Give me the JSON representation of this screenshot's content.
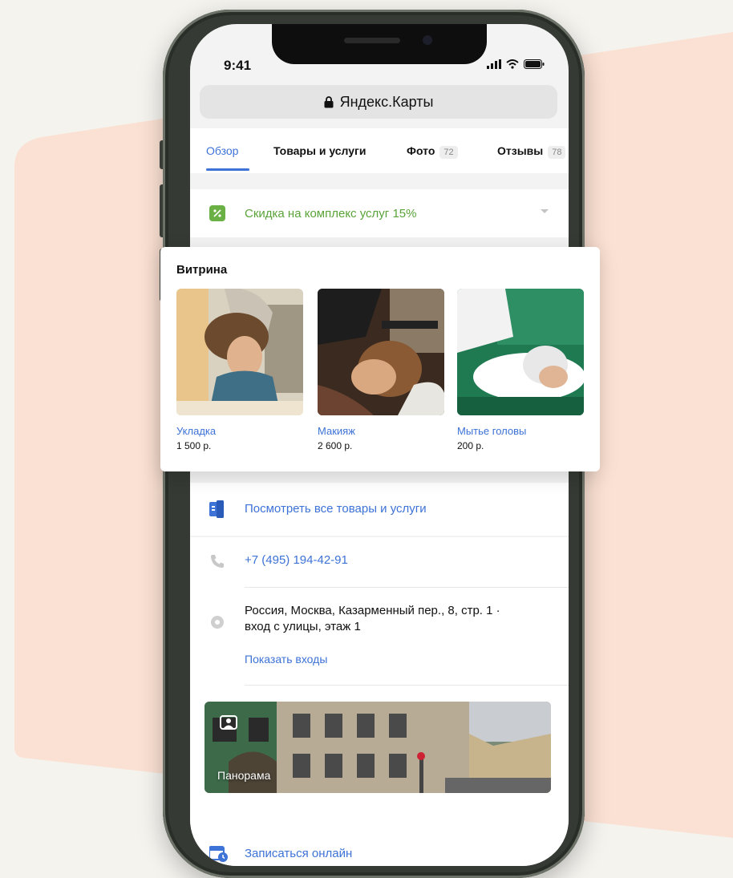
{
  "status_bar": {
    "time": "9:41"
  },
  "browser": {
    "address": "Яндекс.Карты"
  },
  "tabs": [
    {
      "label": "Обзор",
      "active": true
    },
    {
      "label": "Товары и услуги"
    },
    {
      "label": "Фото",
      "count": "72"
    },
    {
      "label": "Отзывы",
      "count": "78"
    }
  ],
  "discount": {
    "label": "Скидка на комплекс услуг 15%"
  },
  "showcase": {
    "title": "Витрина",
    "items": [
      {
        "name": "Укладка",
        "price": "1 500 р."
      },
      {
        "name": "Макияж",
        "price": "2 600 р."
      },
      {
        "name": "Мытье головы",
        "price": "200 р."
      }
    ]
  },
  "all_services": {
    "label": "Посмотреть все товары и услуги"
  },
  "contacts": {
    "phone": "+7 (495) 194-42-91",
    "address_line1": "Россия, Москва, Казарменный пер., 8, стр. 1 ·",
    "address_line2": "вход с улицы, этаж 1",
    "show_entrances": "Показать входы"
  },
  "panorama": {
    "label": "Панорама"
  },
  "booking": {
    "label": "Записаться онлайн"
  },
  "colors": {
    "accent": "#3d72d6",
    "discount": "#5aa33a",
    "background_shape": "#fbe1d3"
  }
}
